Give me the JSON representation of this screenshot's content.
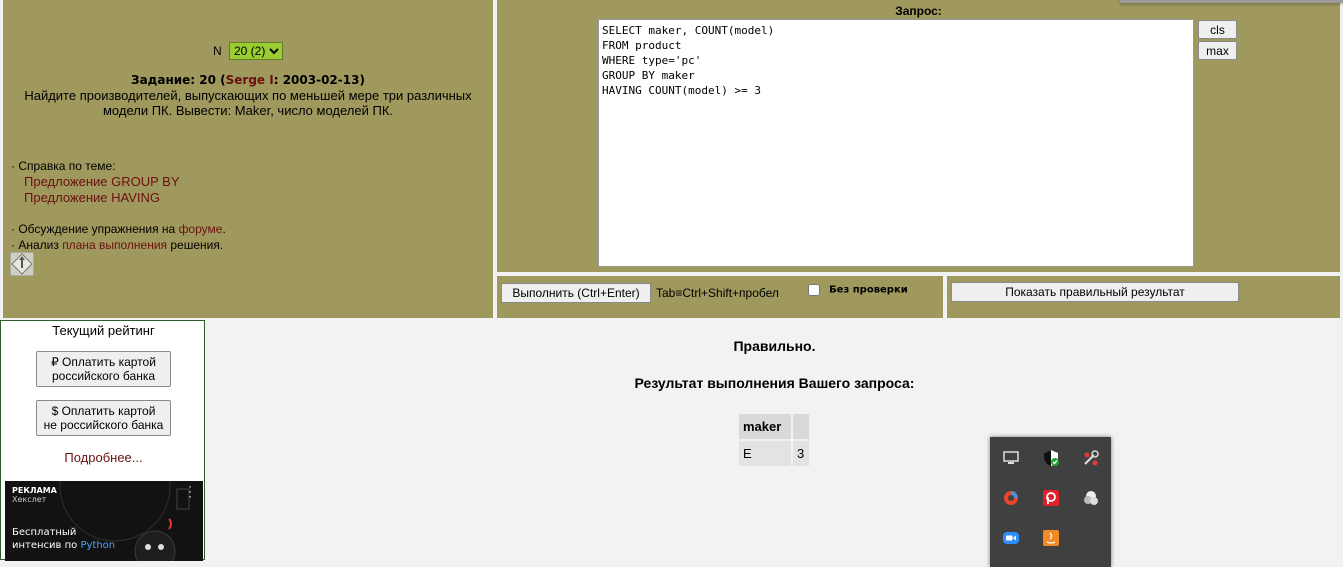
{
  "task_panel": {
    "n_label": "N",
    "n_selected": "20 (2)",
    "task_prefix": "Задание: 20 (",
    "author": "Serge I",
    "task_date": ": 2003-02-13)",
    "description_line1": "Найдите производителей, выпускающих по меньшей мере три различных",
    "description_line2": "модели ПК. Вывести: Maker, число моделей ПК.",
    "help_heading": "· Справка по теме:",
    "help_links": [
      "Предложение GROUP BY",
      "Предложение HAVING"
    ],
    "discussion_prefix": "· Обсуждение упражнения на ",
    "discussion_link": "форуме",
    "discussion_suffix": ".",
    "analysis_prefix": "· Анализ ",
    "analysis_link": "плана выполнения",
    "analysis_suffix": " решения."
  },
  "query_panel": {
    "label": "Запрос:",
    "sql": "SELECT maker, COUNT(model)\nFROM product\nWHERE type='pc'\nGROUP BY maker\nHAVING COUNT(model) >= 3",
    "cls_label": "cls",
    "max_label": "max"
  },
  "controls": {
    "run_label": "Выполнить (Ctrl+Enter)",
    "hint": "Tab≡Ctrl+Shift+пробел",
    "nocheck_label": "Без проверки",
    "show_result_label": "Показать правильный результат"
  },
  "sidebar": {
    "rating": "Текущий рейтинг",
    "pay_rub_line1": "₽ Оплатить картой",
    "pay_rub_line2": "российского банка",
    "pay_usd_line1": "$ Оплатить картой",
    "pay_usd_line2": "не российского банка",
    "more": "Подробнее...",
    "ad_label": "РЕКЛАМА",
    "ad_brand": "Хекслет",
    "ad_text_line1": "Бесплатный",
    "ad_text_line2_prefix": "интенсив по ",
    "ad_text_highlight": "Python"
  },
  "result": {
    "verdict": "Правильно.",
    "title": "Результат выполнения Вашего запроса:",
    "columns": [
      "maker",
      ""
    ],
    "rows": [
      [
        "E",
        "3"
      ]
    ]
  },
  "tray_icons": [
    "monitor-icon",
    "security-shield-icon",
    "tools-icon",
    "drive-icon",
    "pdf-icon",
    "cloud-icon",
    "zoom-video-icon",
    "java-icon"
  ]
}
